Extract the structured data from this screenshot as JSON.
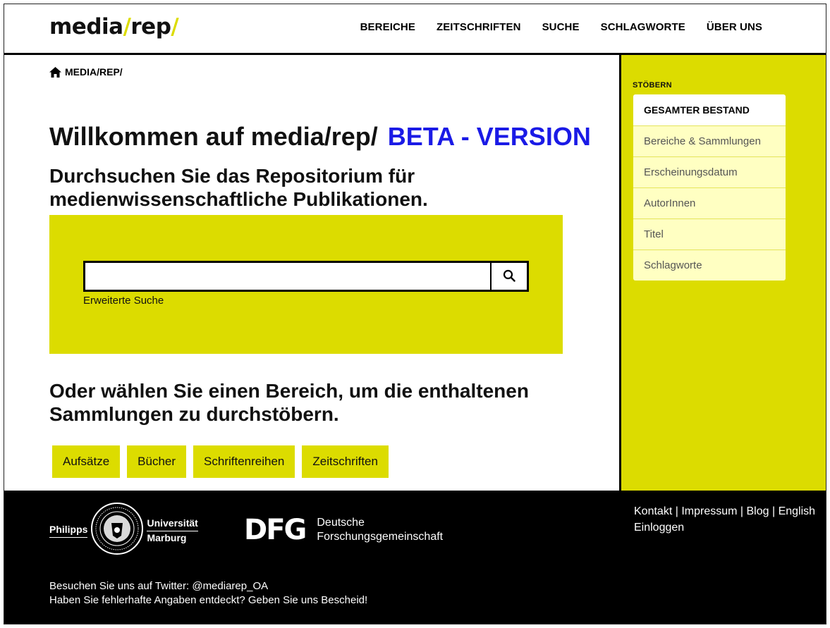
{
  "header": {
    "logo_main": "media",
    "logo_slash1": "/",
    "logo_rep": "rep",
    "logo_slash2": "/",
    "nav": [
      "BEREICHE",
      "ZEITSCHRIFTEN",
      "SUCHE",
      "SCHLAGWORTE",
      "ÜBER UNS"
    ]
  },
  "breadcrumb": {
    "home_label": "MEDIA/REP/"
  },
  "main": {
    "welcome": "Willkommen auf media/rep/",
    "beta": "BETA - VERSION",
    "subtitle": "Durchsuchen Sie das Repositorium für medienwissenschaftliche Publikationen.",
    "search": {
      "value": "",
      "placeholder": "",
      "advanced_label": "Erweiterte Suche"
    },
    "choose_heading": "Oder wählen Sie einen Bereich, um die enthaltenen Sammlungen zu durchstöbern.",
    "areas": [
      "Aufsätze",
      "Bücher",
      "Schriftenreihen",
      "Zeitschriften"
    ]
  },
  "sidebar": {
    "title": "STÖBERN",
    "items": [
      "GESAMTER BESTAND",
      "Bereiche & Sammlungen",
      "Erscheinungsdatum",
      "AutorInnen",
      "Titel",
      "Schlagworte"
    ]
  },
  "footer": {
    "uni_left": "Philipps",
    "uni_right_1": "Universität",
    "uni_right_2": "Marburg",
    "dfg_mark": "DFG",
    "dfg_line1": "Deutsche",
    "dfg_line2": "Forschungsgemeinschaft",
    "links": [
      "Kontakt",
      "Impressum",
      "Blog",
      "English"
    ],
    "login": "Einloggen",
    "twitter": "Besuchen Sie uns auf Twitter: @mediarep_OA",
    "report": "Haben Sie fehlerhafte Angaben entdeckt? Geben Sie uns Bescheid!"
  },
  "colors": {
    "accent": "#dcdc00",
    "beta": "#1a1ae6",
    "footer_bg": "#000000",
    "sidebar_item_bg": "#ffffc2"
  },
  "icons": {
    "home": "home-icon",
    "search": "search-icon",
    "seal": "university-seal-icon"
  }
}
